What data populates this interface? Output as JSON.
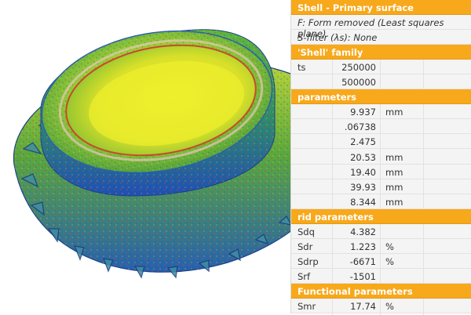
{
  "panel": {
    "rows": [
      {
        "kind": "header",
        "text": "Shell - Primary surface"
      },
      {
        "kind": "info",
        "text": "F: Form removed (Least squares plane)"
      },
      {
        "kind": "info",
        "text": "S-filter (λs): None"
      },
      {
        "kind": "header",
        "text": "'Shell' family"
      },
      {
        "kind": "param",
        "name": "ts",
        "value": "250000",
        "unit": ""
      },
      {
        "kind": "param",
        "name": "",
        "value": "500000",
        "unit": ""
      },
      {
        "kind": "header",
        "text": "parameters"
      },
      {
        "kind": "param",
        "name": "",
        "value": "9.937",
        "unit": "mm"
      },
      {
        "kind": "param",
        "name": "",
        "value": ".06738",
        "unit": ""
      },
      {
        "kind": "param",
        "name": "",
        "value": "2.475",
        "unit": ""
      },
      {
        "kind": "param",
        "name": "",
        "value": "20.53",
        "unit": "mm"
      },
      {
        "kind": "param",
        "name": "",
        "value": "19.40",
        "unit": "mm"
      },
      {
        "kind": "param",
        "name": "",
        "value": "39.93",
        "unit": "mm"
      },
      {
        "kind": "param",
        "name": "",
        "value": "8.344",
        "unit": "mm"
      },
      {
        "kind": "header",
        "text": "rid parameters"
      },
      {
        "kind": "param",
        "name": "Sdq",
        "value": "4.382",
        "unit": ""
      },
      {
        "kind": "param",
        "name": "Sdr",
        "value": "1.223",
        "unit": "%"
      },
      {
        "kind": "param",
        "name": "Sdrp",
        "value": "-6671",
        "unit": "%"
      },
      {
        "kind": "param",
        "name": "Srf",
        "value": "-1501",
        "unit": ""
      },
      {
        "kind": "header",
        "text": "Functional parameters"
      },
      {
        "kind": "param",
        "name": "Smr",
        "value": "17.74",
        "unit": "%"
      }
    ]
  },
  "colors": {
    "header_bg": "#f7a81b",
    "surface_low": "#1f4fb5",
    "surface_mid": "#4caa3a",
    "surface_high": "#e9e62a",
    "surface_peak": "#d9402a"
  },
  "icons": [
    "gear-3d-render"
  ]
}
